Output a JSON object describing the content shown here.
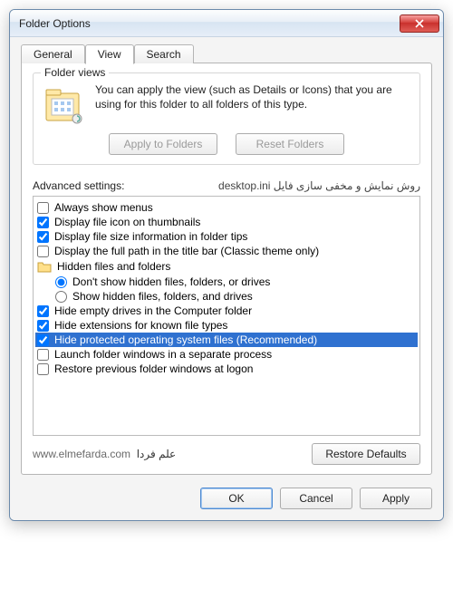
{
  "window": {
    "title": "Folder Options"
  },
  "tabs": {
    "general": "General",
    "view": "View",
    "search": "Search",
    "active": "View"
  },
  "folder_views": {
    "legend": "Folder views",
    "description": "You can apply the view (such as Details or Icons) that you are using for this folder to all folders of this type.",
    "apply_btn": "Apply to Folders",
    "reset_btn": "Reset Folders"
  },
  "advanced": {
    "label": "Advanced settings:",
    "annotation": "روش نمایش و مخفی سازی فایل desktop.ini",
    "items": {
      "always_show_menus": "Always show menus",
      "display_file_icon": "Display file icon on thumbnails",
      "display_file_size": "Display file size information in folder tips",
      "display_full_path": "Display the full path in the title bar (Classic theme only)",
      "hidden_folder_group": "Hidden files and folders",
      "dont_show_hidden": "Don't show hidden files, folders, or drives",
      "show_hidden": "Show hidden files, folders, and drives",
      "hide_empty_drives": "Hide empty drives in the Computer folder",
      "hide_extensions": "Hide extensions for known file types",
      "hide_protected": "Hide protected operating system files (Recommended)",
      "launch_separate": "Launch folder windows in a separate process",
      "restore_previous": "Restore previous folder windows at logon"
    },
    "restore_defaults": "Restore Defaults"
  },
  "footer": {
    "site_url": "www.elmefarda.com",
    "site_name": "علم فردا",
    "ok": "OK",
    "cancel": "Cancel",
    "apply": "Apply"
  }
}
